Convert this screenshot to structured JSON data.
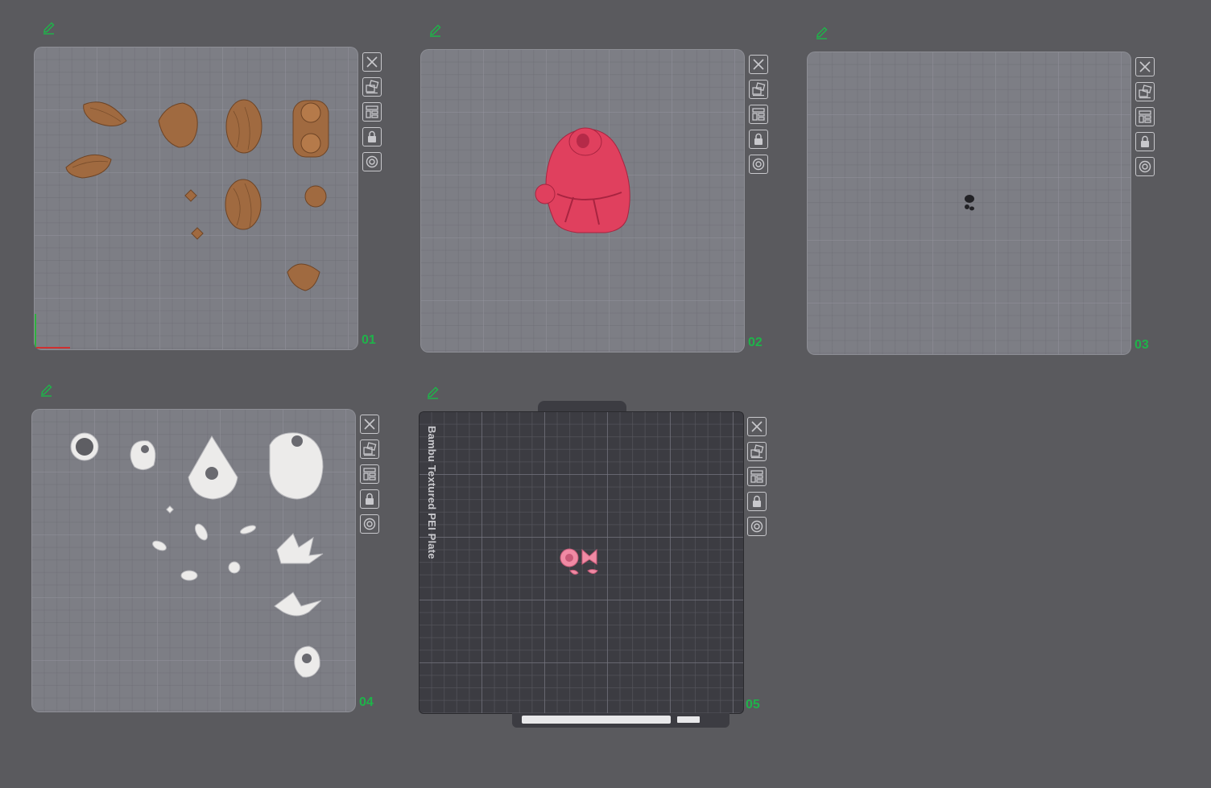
{
  "colors": {
    "background": "#5a5a5e",
    "plate_light": "#7d7e85",
    "plate_dark": "#3c3c42",
    "plate_number": "#1fb34a",
    "edit_icon": "#1fb34a",
    "model_brown": "#a06a40",
    "model_pink": "#e0405e",
    "model_white": "#ecebea",
    "model_light_pink": "#f08aa4",
    "model_black": "#222226"
  },
  "plates": [
    {
      "number": "01",
      "tools": [
        "close-icon",
        "auto-orient-icon",
        "arrange-icon",
        "lock-icon",
        "settings-icon"
      ]
    },
    {
      "number": "02",
      "tools": [
        "close-icon",
        "auto-orient-icon",
        "arrange-icon",
        "lock-icon",
        "settings-icon"
      ]
    },
    {
      "number": "03",
      "tools": [
        "close-icon",
        "auto-orient-icon",
        "arrange-icon",
        "lock-icon",
        "settings-icon"
      ]
    },
    {
      "number": "04",
      "tools": [
        "close-icon",
        "auto-orient-icon",
        "arrange-icon",
        "lock-icon",
        "settings-icon"
      ]
    },
    {
      "number": "05",
      "plate_type_label": "Bambu Textured PEI Plate",
      "tools": [
        "close-icon",
        "auto-orient-icon",
        "arrange-icon",
        "lock-icon",
        "settings-icon"
      ]
    }
  ]
}
